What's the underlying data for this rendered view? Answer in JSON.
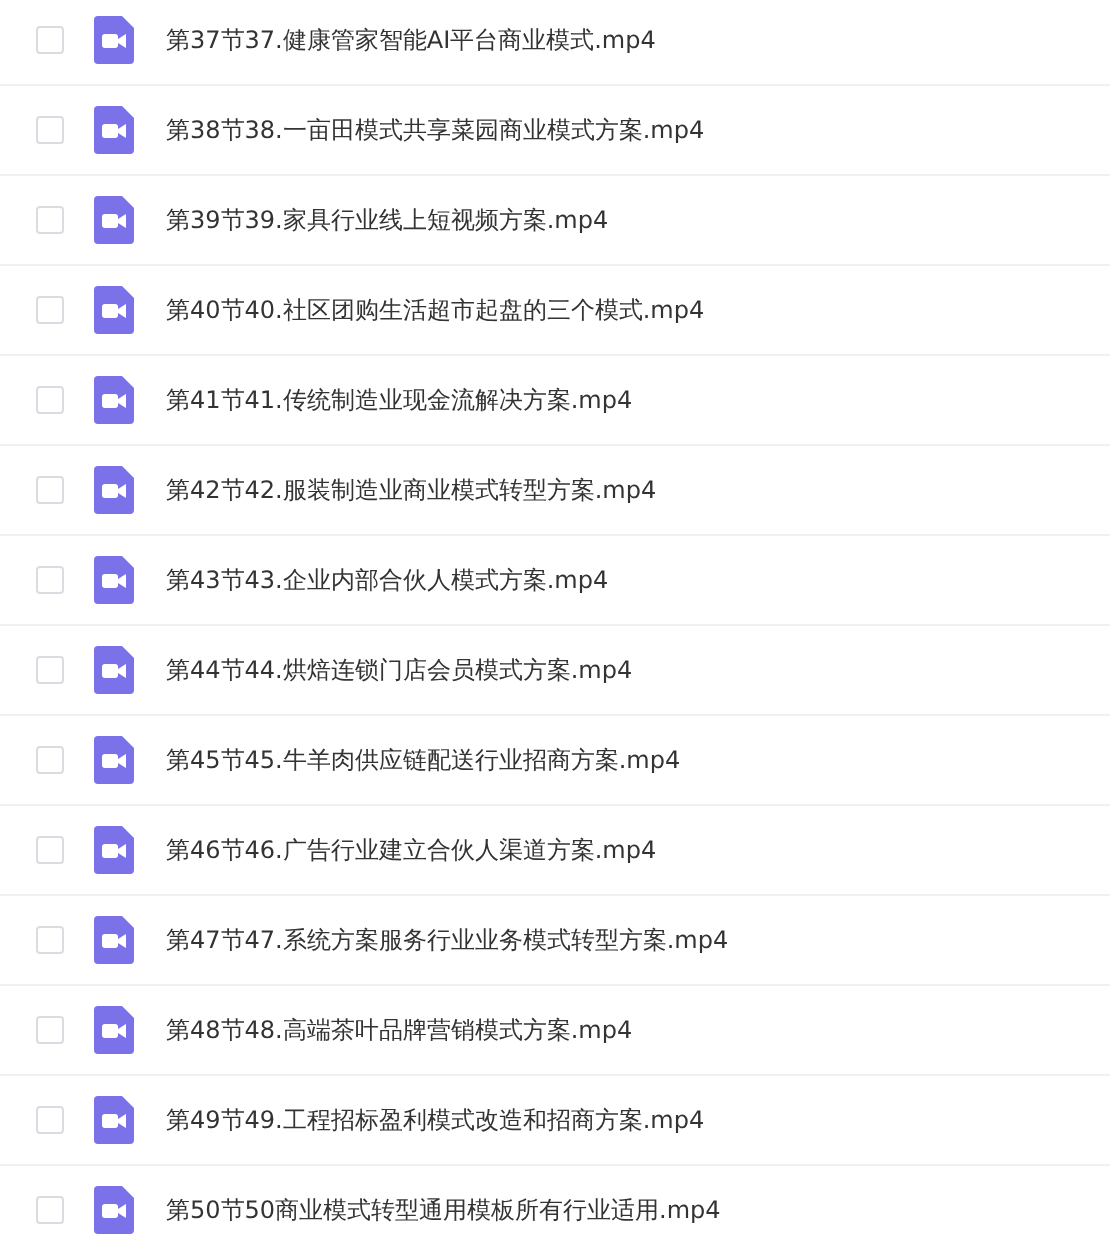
{
  "files": [
    {
      "name": "第37节37.健康管家智能AI平台商业模式.mp4",
      "checked": false
    },
    {
      "name": "第38节38.一亩田模式共享菜园商业模式方案.mp4",
      "checked": false
    },
    {
      "name": "第39节39.家具行业线上短视频方案.mp4",
      "checked": false
    },
    {
      "name": "第40节40.社区团购生活超市起盘的三个模式.mp4",
      "checked": false
    },
    {
      "name": "第41节41.传统制造业现金流解决方案.mp4",
      "checked": false
    },
    {
      "name": "第42节42.服装制造业商业模式转型方案.mp4",
      "checked": false
    },
    {
      "name": "第43节43.企业内部合伙人模式方案.mp4",
      "checked": false
    },
    {
      "name": "第44节44.烘焙连锁门店会员模式方案.mp4",
      "checked": false
    },
    {
      "name": "第45节45.牛羊肉供应链配送行业招商方案.mp4",
      "checked": false
    },
    {
      "name": "第46节46.广告行业建立合伙人渠道方案.mp4",
      "checked": false
    },
    {
      "name": "第47节47.系统方案服务行业业务模式转型方案.mp4",
      "checked": false
    },
    {
      "name": "第48节48.高端茶叶品牌营销模式方案.mp4",
      "checked": false
    },
    {
      "name": "第49节49.工程招标盈利模式改造和招商方案.mp4",
      "checked": false
    },
    {
      "name": "第50节50商业模式转型通用模板所有行业适用.mp4",
      "checked": false
    }
  ]
}
